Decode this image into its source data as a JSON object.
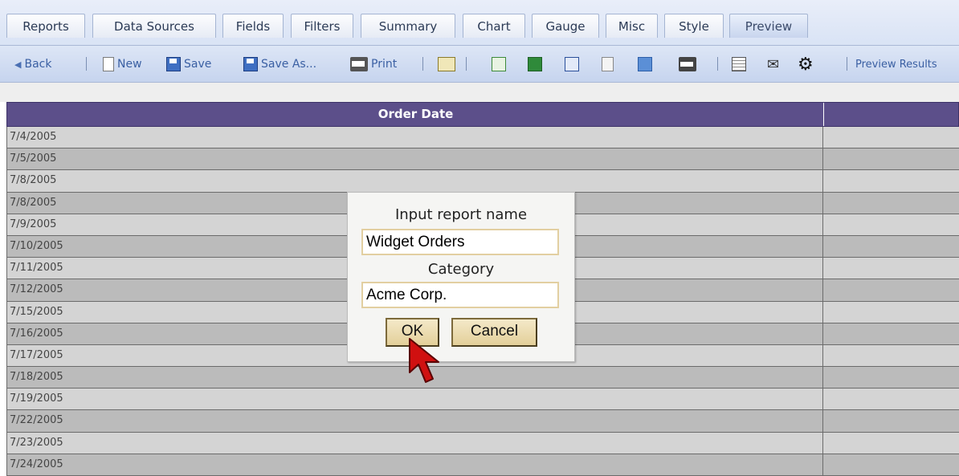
{
  "tabs": [
    {
      "label": "Reports"
    },
    {
      "label": "Data Sources"
    },
    {
      "label": "Fields"
    },
    {
      "label": "Filters"
    },
    {
      "label": "Summary"
    },
    {
      "label": "Chart"
    },
    {
      "label": "Gauge"
    },
    {
      "label": "Misc"
    },
    {
      "label": "Style"
    },
    {
      "label": "Preview",
      "active": true
    }
  ],
  "toolbar": {
    "back_label": "Back",
    "new_label": "New",
    "save_label": "Save",
    "save_as_label": "Save As...",
    "print_label": "Print",
    "preview_results_label": "Preview Results"
  },
  "grid": {
    "column_header": "Order Date",
    "rows": [
      "7/4/2005",
      "7/5/2005",
      "7/8/2005",
      "7/8/2005",
      "7/9/2005",
      "7/10/2005",
      "7/11/2005",
      "7/12/2005",
      "7/15/2005",
      "7/16/2005",
      "7/17/2005",
      "7/18/2005",
      "7/19/2005",
      "7/22/2005",
      "7/23/2005",
      "7/24/2005"
    ]
  },
  "dialog": {
    "name_label": "Input report name",
    "name_value": "Widget Orders",
    "category_label": "Category",
    "category_value": "Acme Corp.",
    "ok_label": "OK",
    "cancel_label": "Cancel"
  },
  "colors": {
    "header_bg": "#5c4f8a",
    "button_face": "#e8d9ad",
    "input_border": "#e2cfa1",
    "cursor": "#d01010"
  }
}
